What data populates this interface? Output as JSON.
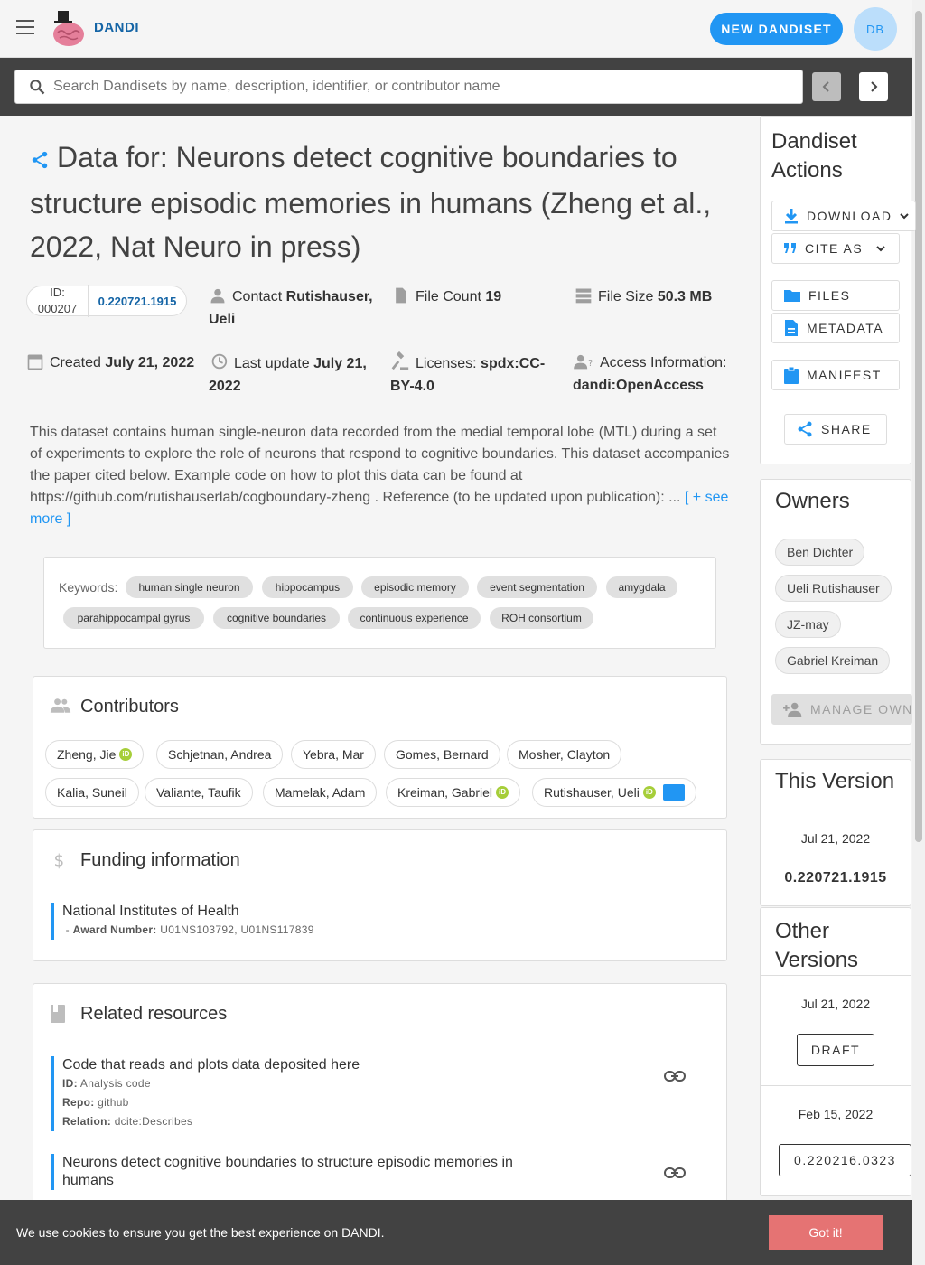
{
  "app": {
    "brand": "DANDI",
    "new_button": "NEW DANDISET",
    "avatar_initials": "DB"
  },
  "search": {
    "placeholder": "Search Dandisets by name, description, identifier, or contributor name"
  },
  "dandiset": {
    "title": "Data for: Neurons detect cognitive boundaries to structure episodic memories in humans (Zheng et al., 2022, Nat Neuro in press)",
    "id_label": "ID:",
    "id_value": "000207",
    "version": "0.220721.1915",
    "contact_label": "Contact",
    "contact_value": "Rutishauser, Ueli",
    "file_count_label": "File Count",
    "file_count_value": "19",
    "file_size_label": "File Size",
    "file_size_value": "50.3 MB",
    "created_label": "Created",
    "created_value": "July 21, 2022",
    "updated_label": "Last update",
    "updated_value": "July 21, 2022",
    "license_label": "Licenses:",
    "license_value": "spdx:CC-BY-4.0",
    "access_label": "Access Information:",
    "access_value": "dandi:OpenAccess",
    "description": "This dataset contains human single-neuron data recorded from the medial temporal lobe (MTL) during a set of experiments to explore the role of neurons that respond to cognitive boundaries. This dataset accompanies the paper cited below. Example code on how to plot this data can be found at https://github.com/rutishauserlab/cogboundary-zheng . Reference (to be updated upon publication): ...",
    "see_more": "[ + see more ]"
  },
  "keywords": {
    "label": "Keywords:",
    "items": [
      "human single neuron",
      "hippocampus",
      "episodic memory",
      "event segmentation",
      "amygdala",
      "parahippocampal gyrus",
      "cognitive boundaries",
      "continuous experience",
      "ROH consortium"
    ]
  },
  "contributors": {
    "title": "Contributors",
    "items": [
      "Zheng, Jie",
      "Schjetnan, Andrea",
      "Yebra, Mar",
      "Gomes, Bernard",
      "Mosher, Clayton",
      "Kalia, Suneil",
      "Valiante, Taufik",
      "Mamelak, Adam",
      "Kreiman, Gabriel",
      "Rutishauser, Ueli"
    ]
  },
  "funding": {
    "title": "Funding information",
    "funder": "National Institutes of Health",
    "award_label": "Award Number:",
    "award_value": "U01NS103792, U01NS117839"
  },
  "related": {
    "title": "Related resources",
    "items": [
      {
        "title": "Code that reads and plots data deposited here",
        "id_label": "ID:",
        "id": "Analysis code",
        "repo_label": "Repo:",
        "repo": "github",
        "relation_label": "Relation:",
        "relation": "dcite:Describes"
      },
      {
        "title": "Neurons detect cognitive boundaries to structure episodic memories in humans"
      }
    ]
  },
  "actions": {
    "title": "Dandiset Actions",
    "download": "DOWNLOAD",
    "cite": "CITE AS",
    "files": "FILES",
    "metadata": "METADATA",
    "manifest": "MANIFEST",
    "share": "SHARE"
  },
  "owners": {
    "title": "Owners",
    "items": [
      "Ben Dichter",
      "Ueli Rutishauser",
      "JZ-may",
      "Gabriel Kreiman"
    ],
    "manage": "MANAGE OWNERS"
  },
  "this_version": {
    "title": "This Version",
    "date": "Jul 21, 2022",
    "version": "0.220721.1915"
  },
  "other_versions": {
    "title": "Other Versions",
    "items": [
      {
        "date": "Jul 21, 2022",
        "label": "DRAFT"
      },
      {
        "date": "Feb 15, 2022",
        "label": "0.220216.0323"
      }
    ]
  },
  "cookie": {
    "text": "We use cookies to ensure you get the best experience on DANDI.",
    "button": "Got it!"
  },
  "colors": {
    "primary": "#2196f3",
    "dark": "#424242",
    "cookie_button": "#e57373"
  }
}
